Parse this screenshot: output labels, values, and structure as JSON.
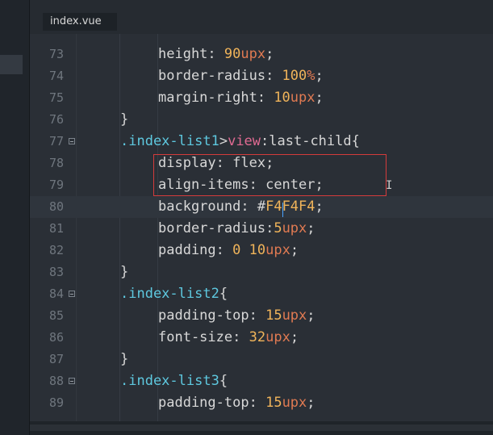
{
  "tab": {
    "label": "index.vue"
  },
  "lines": [
    {
      "n": "73",
      "fold": false,
      "indent": 2,
      "tokens": [
        {
          "t": "height",
          "c": "prop"
        },
        {
          "t": ": ",
          "c": "plain"
        },
        {
          "t": "90",
          "c": "num"
        },
        {
          "t": "upx",
          "c": "unit"
        },
        {
          "t": ";",
          "c": "plain"
        }
      ]
    },
    {
      "n": "74",
      "fold": false,
      "indent": 2,
      "tokens": [
        {
          "t": "border-radius",
          "c": "prop"
        },
        {
          "t": ": ",
          "c": "plain"
        },
        {
          "t": "100",
          "c": "num"
        },
        {
          "t": "%",
          "c": "unit"
        },
        {
          "t": ";",
          "c": "plain"
        }
      ]
    },
    {
      "n": "75",
      "fold": false,
      "indent": 2,
      "tokens": [
        {
          "t": "margin-right",
          "c": "prop"
        },
        {
          "t": ": ",
          "c": "plain"
        },
        {
          "t": "10",
          "c": "num"
        },
        {
          "t": "upx",
          "c": "unit"
        },
        {
          "t": ";",
          "c": "plain"
        }
      ]
    },
    {
      "n": "76",
      "fold": false,
      "indent": 1,
      "tokens": [
        {
          "t": "}",
          "c": "plain"
        }
      ]
    },
    {
      "n": "77",
      "fold": true,
      "indent": 1,
      "tokens": [
        {
          "t": ".index-list1",
          "c": "sel"
        },
        {
          "t": ">",
          "c": "plain"
        },
        {
          "t": "view",
          "c": "tag"
        },
        {
          "t": ":last-child",
          "c": "pseudo"
        },
        {
          "t": "{",
          "c": "plain"
        }
      ]
    },
    {
      "n": "78",
      "fold": false,
      "indent": 2,
      "tokens": [
        {
          "t": "display",
          "c": "prop"
        },
        {
          "t": ": ",
          "c": "plain"
        },
        {
          "t": "flex",
          "c": "plain"
        },
        {
          "t": ";",
          "c": "plain"
        }
      ]
    },
    {
      "n": "79",
      "fold": false,
      "indent": 2,
      "tokens": [
        {
          "t": "align-items",
          "c": "prop"
        },
        {
          "t": ": ",
          "c": "plain"
        },
        {
          "t": "center",
          "c": "plain"
        },
        {
          "t": ";",
          "c": "plain"
        }
      ]
    },
    {
      "n": "80",
      "fold": false,
      "indent": 2,
      "current": true,
      "tokens": [
        {
          "t": "background",
          "c": "prop"
        },
        {
          "t": ": ",
          "c": "plain"
        },
        {
          "t": "#",
          "c": "hash"
        },
        {
          "t": "F4F4F4",
          "c": "num"
        },
        {
          "t": ";",
          "c": "plain"
        }
      ]
    },
    {
      "n": "81",
      "fold": false,
      "indent": 2,
      "tokens": [
        {
          "t": "border-radius",
          "c": "prop"
        },
        {
          "t": ":",
          "c": "plain"
        },
        {
          "t": "5",
          "c": "num"
        },
        {
          "t": "upx",
          "c": "unit"
        },
        {
          "t": ";",
          "c": "plain"
        }
      ]
    },
    {
      "n": "82",
      "fold": false,
      "indent": 2,
      "tokens": [
        {
          "t": "padding",
          "c": "prop"
        },
        {
          "t": ": ",
          "c": "plain"
        },
        {
          "t": "0",
          "c": "num"
        },
        {
          "t": " ",
          "c": "plain"
        },
        {
          "t": "10",
          "c": "num"
        },
        {
          "t": "upx",
          "c": "unit"
        },
        {
          "t": ";",
          "c": "plain"
        }
      ]
    },
    {
      "n": "83",
      "fold": false,
      "indent": 1,
      "tokens": [
        {
          "t": "}",
          "c": "plain"
        }
      ]
    },
    {
      "n": "84",
      "fold": true,
      "indent": 1,
      "tokens": [
        {
          "t": ".index-list2",
          "c": "sel"
        },
        {
          "t": "{",
          "c": "plain"
        }
      ]
    },
    {
      "n": "85",
      "fold": false,
      "indent": 2,
      "tokens": [
        {
          "t": "padding-top",
          "c": "prop"
        },
        {
          "t": ": ",
          "c": "plain"
        },
        {
          "t": "15",
          "c": "num"
        },
        {
          "t": "upx",
          "c": "unit"
        },
        {
          "t": ";",
          "c": "plain"
        }
      ]
    },
    {
      "n": "86",
      "fold": false,
      "indent": 2,
      "tokens": [
        {
          "t": "font-size",
          "c": "prop"
        },
        {
          "t": ": ",
          "c": "plain"
        },
        {
          "t": "32",
          "c": "num"
        },
        {
          "t": "upx",
          "c": "unit"
        },
        {
          "t": ";",
          "c": "plain"
        }
      ]
    },
    {
      "n": "87",
      "fold": false,
      "indent": 1,
      "tokens": [
        {
          "t": "}",
          "c": "plain"
        }
      ]
    },
    {
      "n": "88",
      "fold": true,
      "indent": 1,
      "tokens": [
        {
          "t": ".index-list3",
          "c": "sel"
        },
        {
          "t": "{",
          "c": "plain"
        }
      ]
    },
    {
      "n": "89",
      "fold": false,
      "indent": 2,
      "tokens": [
        {
          "t": "padding-top",
          "c": "prop"
        },
        {
          "t": ": ",
          "c": "plain"
        },
        {
          "t": "15",
          "c": "num"
        },
        {
          "t": "upx",
          "c": "unit"
        },
        {
          "t": ";",
          "c": "plain"
        }
      ]
    }
  ],
  "colors": {
    "property": "#d8d8d8",
    "number": "#f0b45a",
    "unit": "#e07a52",
    "selector": "#5ec8df",
    "tag": "#e06a92",
    "highlight_border": "#d43b3b",
    "caret": "#4aa3ff"
  }
}
